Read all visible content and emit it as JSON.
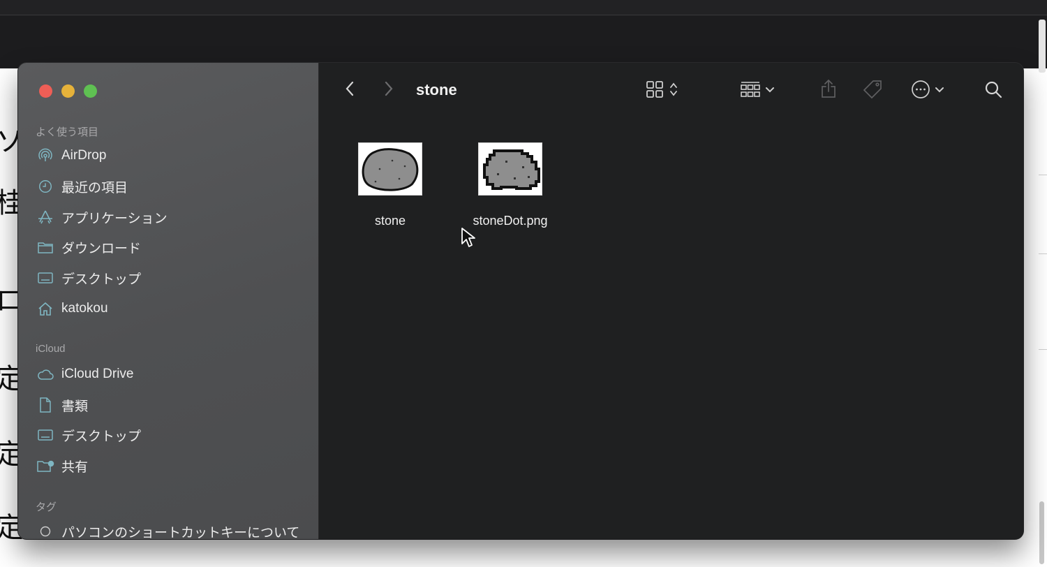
{
  "sidebar": {
    "favorites_label": "よく使う項目",
    "favorites": [
      {
        "label": "AirDrop",
        "icon": "airdrop-icon"
      },
      {
        "label": "最近の項目",
        "icon": "clock-icon"
      },
      {
        "label": "アプリケーション",
        "icon": "applications-icon"
      },
      {
        "label": "ダウンロード",
        "icon": "folder-icon"
      },
      {
        "label": "デスクトップ",
        "icon": "desktop-icon"
      },
      {
        "label": "katokou",
        "icon": "home-icon"
      }
    ],
    "icloud_label": "iCloud",
    "icloud": [
      {
        "label": "iCloud Drive",
        "icon": "cloud-icon"
      },
      {
        "label": "書類",
        "icon": "document-icon"
      },
      {
        "label": "デスクトップ",
        "icon": "desktop-icon"
      },
      {
        "label": "共有",
        "icon": "shared-folder-icon"
      }
    ],
    "tags_label": "タグ",
    "tags": [
      {
        "label": "パソコンのショートカットキーについて",
        "icon": "tag-circle-icon"
      }
    ]
  },
  "toolbar": {
    "title": "stone",
    "buttons": [
      "back-icon",
      "forward-icon",
      "icon-view-icon",
      "group-icon",
      "share-icon",
      "tag-icon",
      "more-icon",
      "search-icon"
    ]
  },
  "files": [
    {
      "name": "stone"
    },
    {
      "name": "stoneDot.png"
    }
  ],
  "colors": {
    "sidebar_bg": "#55565a",
    "content_bg": "#1f2021",
    "accent_icon": "#7fb6c2",
    "text": "#ececec"
  },
  "background_glyphs": [
    "ソ",
    "桂",
    "ロ",
    "定",
    "定",
    "定"
  ]
}
